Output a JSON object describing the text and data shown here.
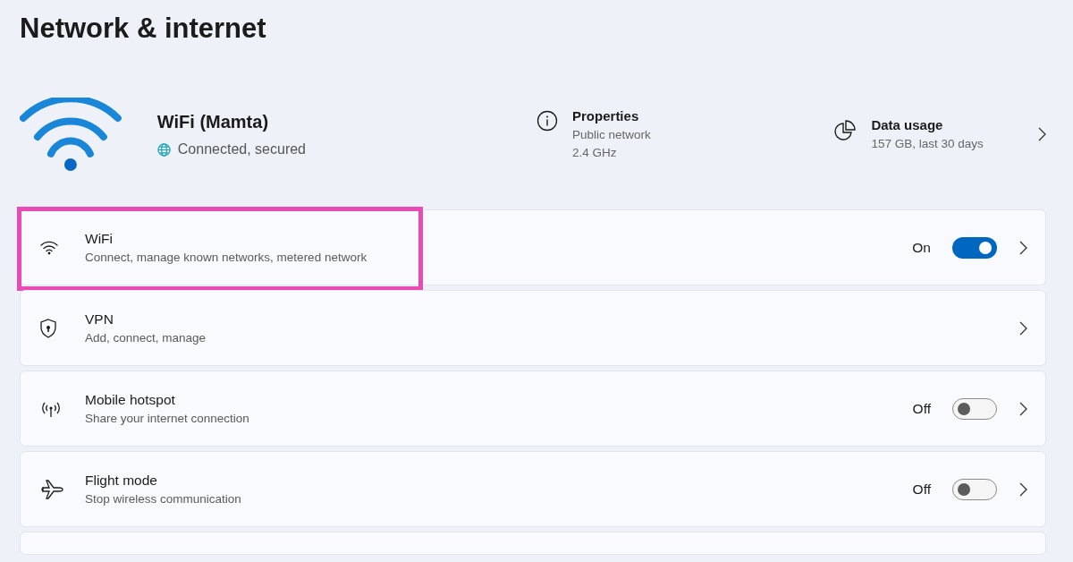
{
  "page_title": "Network & internet",
  "connection": {
    "name": "WiFi (Mamta)",
    "status": "Connected, secured"
  },
  "properties": {
    "title": "Properties",
    "lines": [
      "Public network",
      "2.4 GHz"
    ]
  },
  "data_usage": {
    "title": "Data usage",
    "detail": "157 GB, last 30 days"
  },
  "settings": [
    {
      "kind": "wifi",
      "title": "WiFi",
      "subtitle": "Connect, manage known networks, metered network",
      "toggle_label": "On",
      "on": true,
      "highlighted": true
    },
    {
      "kind": "vpn",
      "title": "VPN",
      "subtitle": "Add, connect, manage",
      "highlighted": false
    },
    {
      "kind": "hotspot",
      "title": "Mobile hotspot",
      "subtitle": "Share your internet connection",
      "toggle_label": "Off",
      "on": false,
      "highlighted": false
    },
    {
      "kind": "flight",
      "title": "Flight mode",
      "subtitle": "Stop wireless communication",
      "toggle_label": "Off",
      "on": false,
      "highlighted": false
    }
  ]
}
